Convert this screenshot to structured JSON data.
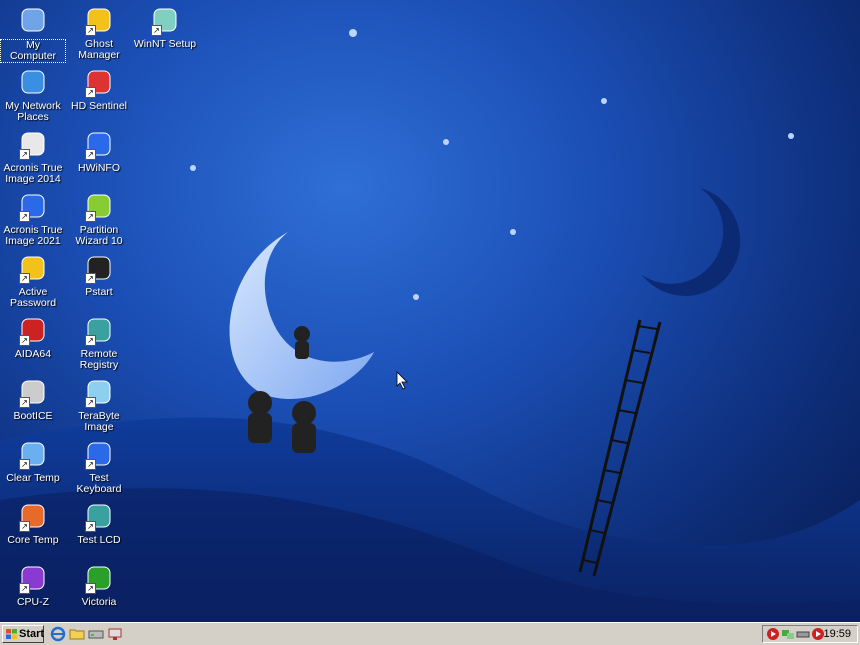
{
  "desktop": {
    "icons": [
      {
        "label": "My Computer",
        "icon": "my-computer-icon",
        "shortcut": false
      },
      {
        "label": "Ghost Manager",
        "icon": "ghost-manager-icon",
        "shortcut": true
      },
      {
        "label": "WinNT Setup",
        "icon": "winnt-setup-icon",
        "shortcut": true
      },
      {
        "label": "My Network Places",
        "icon": "network-places-icon",
        "shortcut": false
      },
      {
        "label": "HD Sentinel",
        "icon": "hd-sentinel-icon",
        "shortcut": true
      },
      {
        "label": "Acronis True Image 2014",
        "icon": "acronis-2014-icon",
        "shortcut": true
      },
      {
        "label": "HWiNFO",
        "icon": "hwinfo-icon",
        "shortcut": true
      },
      {
        "label": "Acronis True Image 2021",
        "icon": "acronis-2021-icon",
        "shortcut": true
      },
      {
        "label": "Partition Wizard 10",
        "icon": "partition-wizard-icon",
        "shortcut": true
      },
      {
        "label": "Active Password",
        "icon": "active-password-icon",
        "shortcut": true
      },
      {
        "label": "Pstart",
        "icon": "pstart-icon",
        "shortcut": true
      },
      {
        "label": "AIDA64",
        "icon": "aida64-icon",
        "shortcut": true
      },
      {
        "label": "Remote Registry",
        "icon": "remote-registry-icon",
        "shortcut": true
      },
      {
        "label": "BootICE",
        "icon": "bootice-icon",
        "shortcut": true
      },
      {
        "label": "TeraByte Image",
        "icon": "terabyte-image-icon",
        "shortcut": true
      },
      {
        "label": "Clear Temp",
        "icon": "clear-temp-icon",
        "shortcut": true
      },
      {
        "label": "Test Keyboard",
        "icon": "test-keyboard-icon",
        "shortcut": true
      },
      {
        "label": "Core Temp",
        "icon": "core-temp-icon",
        "shortcut": true
      },
      {
        "label": "Test LCD",
        "icon": "test-lcd-icon",
        "shortcut": true
      },
      {
        "label": "CPU-Z",
        "icon": "cpu-z-icon",
        "shortcut": true
      },
      {
        "label": "Victoria",
        "icon": "victoria-icon",
        "shortcut": true
      }
    ]
  },
  "taskbar": {
    "start_label": "Start",
    "quick_launch": [
      "ie-icon",
      "folder-icon",
      "drive-icon",
      "network-icon"
    ],
    "tray_icons": [
      "media-icon",
      "network-tray-icon",
      "usb-icon",
      "media-play-icon"
    ],
    "clock": "19:59"
  },
  "colors": {
    "taskbar": "#d4d0c8",
    "desktop": "#1b4fb6"
  }
}
